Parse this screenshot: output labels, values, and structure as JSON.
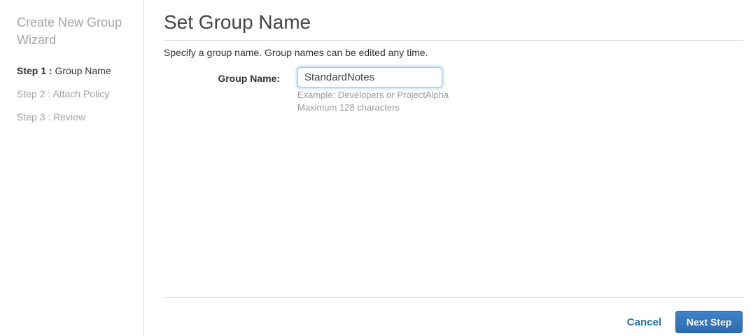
{
  "sidebar": {
    "title": "Create New Group Wizard",
    "steps": [
      {
        "prefix": "Step 1 :",
        "label": "Group Name"
      },
      {
        "prefix": "Step 2 :",
        "label": "Attach Policy"
      },
      {
        "prefix": "Step 3 :",
        "label": "Review"
      }
    ]
  },
  "main": {
    "title": "Set Group Name",
    "description": "Specify a group name. Group names can be edited any time.",
    "form": {
      "group_name_label": "Group Name:",
      "group_name_value": "StandardNotes",
      "hint_example": "Example: Developers or ProjectAlpha",
      "hint_max": "Maximum 128 characters"
    },
    "footer": {
      "cancel_label": "Cancel",
      "next_label": "Next Step"
    }
  },
  "colors": {
    "accent_blue": "#2e72ab",
    "button_top": "#3e84cb",
    "button_bottom": "#2d6bb0",
    "muted_text": "#9b9b9b",
    "divider": "#d5d5d5"
  }
}
